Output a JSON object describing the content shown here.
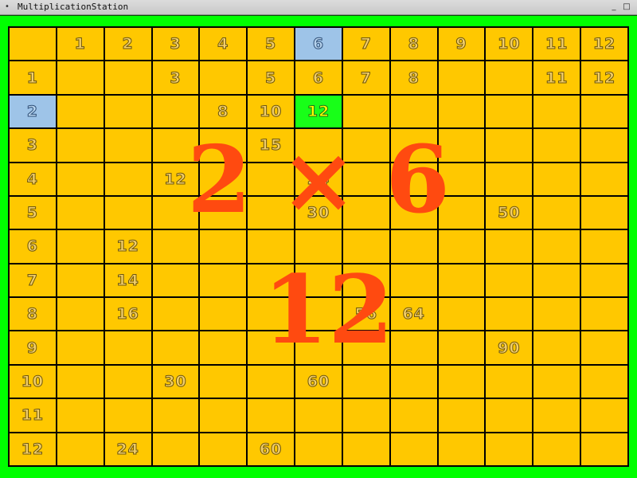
{
  "window": {
    "title": "MultiplicationStation",
    "sys_icon": "•",
    "minimize_glyph": "_",
    "close_glyph": "□"
  },
  "colors": {
    "frame": "#00ff00",
    "cell": "#ffc800",
    "highlight": "#9ec4e8",
    "target": "#18ff18",
    "overlay": "#ff4a10"
  },
  "grid": {
    "col_headers": [
      "",
      "1",
      "2",
      "3",
      "4",
      "5",
      "6",
      "7",
      "8",
      "9",
      "10",
      "11",
      "12"
    ],
    "row_headers": [
      "1",
      "2",
      "3",
      "4",
      "5",
      "6",
      "7",
      "8",
      "9",
      "10",
      "11",
      "12"
    ],
    "cells": [
      [
        "",
        "",
        "3",
        "",
        "5",
        "6",
        "7",
        "8",
        "",
        "",
        "11",
        "12"
      ],
      [
        "",
        "",
        "",
        "8",
        "10",
        "12",
        "",
        "",
        "",
        "",
        "",
        ""
      ],
      [
        "",
        "",
        "",
        "",
        "15",
        "",
        "",
        "",
        "",
        "",
        "",
        ""
      ],
      [
        "",
        "",
        "12",
        "",
        "",
        "24",
        "",
        "",
        "",
        "",
        "",
        ""
      ],
      [
        "",
        "",
        "",
        "",
        "",
        "30",
        "",
        "",
        "",
        "50",
        "",
        ""
      ],
      [
        "",
        "12",
        "",
        "",
        "",
        "",
        "",
        "",
        "",
        "",
        "",
        ""
      ],
      [
        "",
        "14",
        "",
        "",
        "",
        "",
        "",
        "",
        "",
        "",
        "",
        ""
      ],
      [
        "",
        "16",
        "",
        "",
        "",
        "",
        "56",
        "64",
        "",
        "",
        "",
        ""
      ],
      [
        "",
        "",
        "",
        "",
        "",
        "",
        "",
        "",
        "",
        "90",
        "",
        ""
      ],
      [
        "",
        "",
        "30",
        "",
        "",
        "60",
        "",
        "",
        "",
        "",
        "",
        ""
      ],
      [
        "",
        "",
        "",
        "",
        "",
        "",
        "",
        "",
        "",
        "",
        "",
        ""
      ],
      [
        "",
        "24",
        "",
        "",
        "60",
        "",
        "",
        "",
        "",
        "",
        "",
        ""
      ]
    ],
    "selected_row": 2,
    "selected_col": 6
  },
  "equation": {
    "left": "2",
    "operator": "×",
    "right": "6",
    "answer": "12"
  }
}
